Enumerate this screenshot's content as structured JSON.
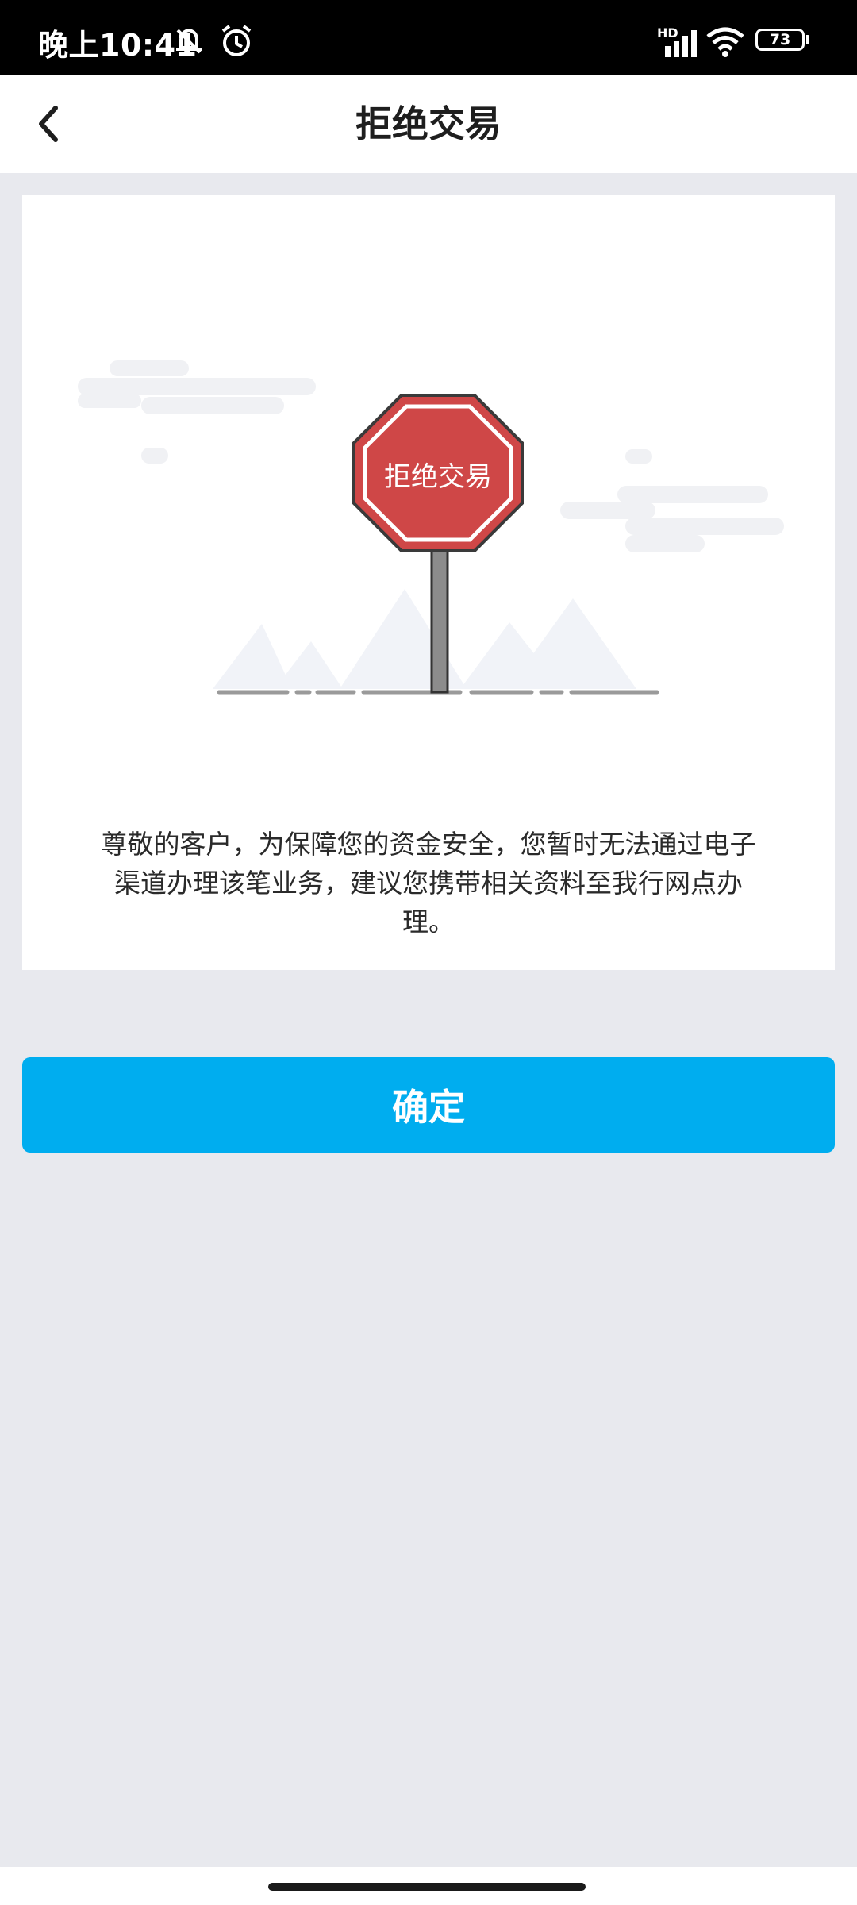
{
  "status_bar": {
    "time": "晚上10:41",
    "battery": "73",
    "network_label": "HD",
    "icons": [
      "mute-icon",
      "alarm-icon",
      "signal-icon",
      "wifi-icon",
      "battery-icon"
    ]
  },
  "nav": {
    "back_icon": "chevron-left-icon",
    "title": "拒绝交易"
  },
  "illustration": {
    "sign_text": "拒绝交易",
    "sign_color": "#cf4747"
  },
  "message": {
    "lines": [
      "尊敬的客户，为保障您的资金安全，您暂时无法通过电子",
      "渠道办理该笔业务，建议您携带相关资料至我行网点办",
      "理。"
    ]
  },
  "confirm_button": {
    "label": "确定",
    "color": "#00adef"
  }
}
